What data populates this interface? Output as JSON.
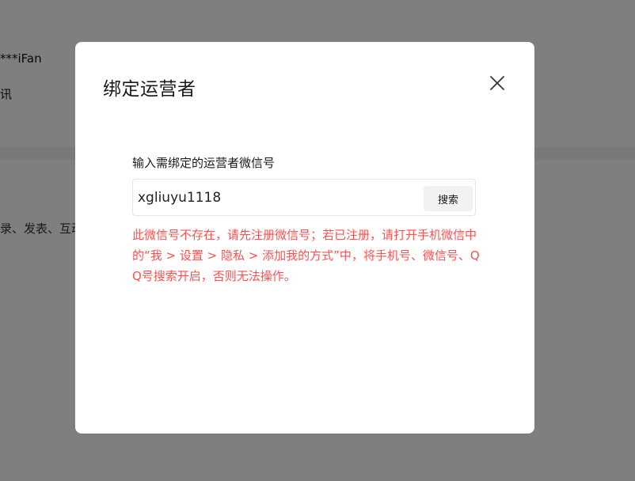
{
  "background": {
    "account_name": "***iFan",
    "partial_char": "讯",
    "partial_desc": "录、发表、互动"
  },
  "dialog": {
    "title": "绑定运营者",
    "close_icon": "close-icon",
    "field_label": "输入需绑定的运营者微信号",
    "input_value": "xgliuyu1118",
    "search_label": "搜索",
    "error_text": "此微信号不存在，请先注册微信号；若已注册，请打开手机微信中的“我 > 设置 > 隐私 > 添加我的方式”中，将手机号、微信号、QQ号搜索开启，否则无法操作。"
  },
  "colors": {
    "overlay": "#808080",
    "error": "#fa5151",
    "dialog_bg": "#ffffff",
    "button_bg": "#f2f2f2"
  }
}
